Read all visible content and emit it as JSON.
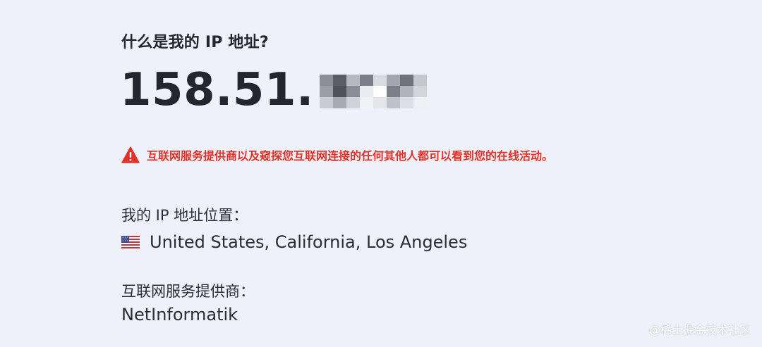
{
  "colors": {
    "background": "#eef1f9",
    "text": "#23262f",
    "warning": "#e0322b"
  },
  "header": {
    "title": "什么是我的 IP 地址?"
  },
  "ip": {
    "visible_prefix": "158.51.",
    "redacted": true
  },
  "warning": {
    "icon": "warning-triangle-icon",
    "text": "互联网服务提供商以及窥探您互联网连接的任何其他人都可以看到您的在线活动。"
  },
  "location": {
    "label": "我的 IP 地址位置：",
    "flag_icon": "us-flag-icon",
    "value": "United States, California, Los Angeles"
  },
  "isp": {
    "label": "互联网服务提供商：",
    "value": "NetInformatik"
  },
  "watermark": {
    "text": "@稀土掘金技术社区"
  }
}
